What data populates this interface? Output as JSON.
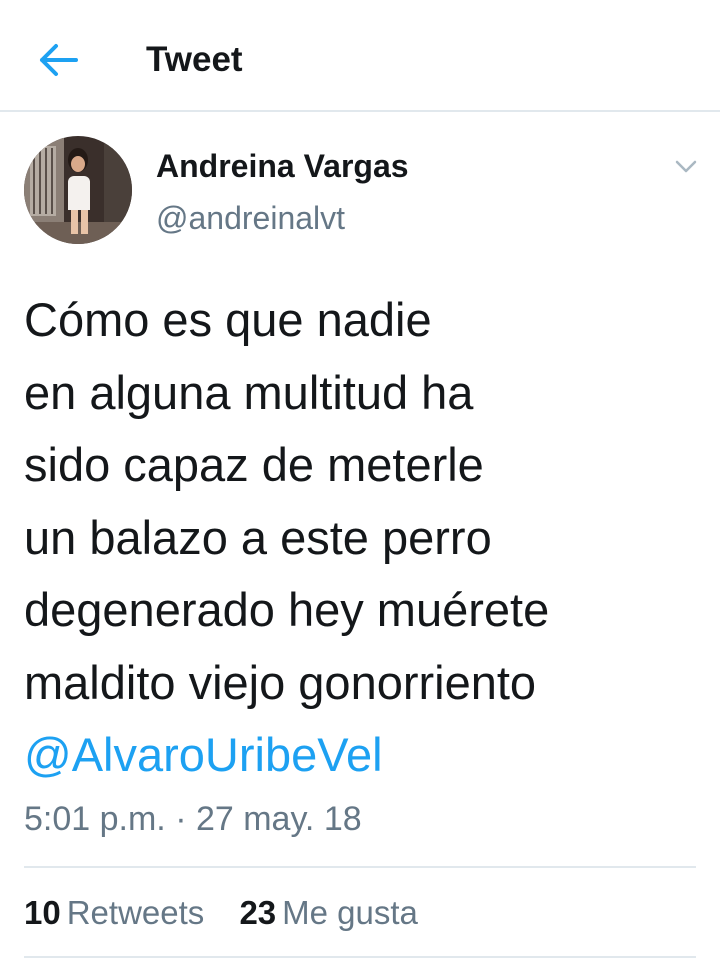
{
  "header": {
    "title": "Tweet",
    "back_icon": "arrow-left-icon"
  },
  "author": {
    "display_name": "Andreina Vargas",
    "handle": "@andreinalvt",
    "avatar": "profile-photo",
    "menu_icon": "chevron-down-icon"
  },
  "tweet": {
    "lines": [
      "Cómo es que nadie",
      "en alguna multitud ha",
      "sido capaz de meterle",
      "un balazo a este perro",
      "degenerado hey muérete",
      "maldito viejo gonorriento"
    ],
    "mention": "@AlvaroUribeVel",
    "timestamp": "5:01 p.m. · 27 may. 18"
  },
  "stats": {
    "retweets_count": "10",
    "retweets_label": "Retweets",
    "likes_count": "23",
    "likes_label": "Me gusta"
  },
  "colors": {
    "accent": "#1da1f2",
    "text_primary": "#14171a",
    "text_secondary": "#657786",
    "divider": "#e1e8ed"
  }
}
